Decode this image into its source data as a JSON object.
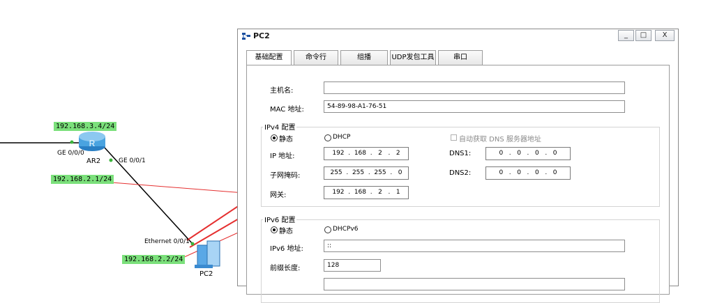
{
  "topology": {
    "router_name": "AR2",
    "router_port_left": "GE 0/0/0",
    "router_port_right": "GE 0/0/1",
    "router_ip_top": "192.168.3.4/24",
    "router_ip_mid": "192.168.2.1/24",
    "pc_port": "Ethernet 0/0/1",
    "pc_ip": "192.168.2.2/24",
    "pc_name": "PC2",
    "tag_color": "#7be07b",
    "arrow_color": "#e53030"
  },
  "window": {
    "title": "PC2",
    "controls": {
      "minimize": "_",
      "maximize": "□",
      "close": "X"
    }
  },
  "tabs": [
    {
      "label": "基础配置",
      "active": true
    },
    {
      "label": "命令行",
      "active": false
    },
    {
      "label": "组播",
      "active": false
    },
    {
      "label": "UDP发包工具",
      "active": false
    },
    {
      "label": "串口",
      "active": false
    }
  ],
  "basic": {
    "hostname_label": "主机名:",
    "hostname_value": "",
    "mac_label": "MAC 地址:",
    "mac_value": "54-89-98-A1-76-51"
  },
  "ipv4": {
    "group_title": "IPv4 配置",
    "static_label": "静态",
    "dhcp_label": "DHCP",
    "auto_dns_label": "自动获取 DNS 服务器地址",
    "ip_label": "IP 地址:",
    "ip_value": "192  .  168  .   2   .   2",
    "mask_label": "子网掩码:",
    "mask_value": "255  .  255  .  255  .   0",
    "gateway_label": "网关:",
    "gateway_value": "192  .  168  .   2   .   1",
    "dns1_label": "DNS1:",
    "dns1_value": "0   .   0   .   0   .   0",
    "dns2_label": "DNS2:",
    "dns2_value": "0   .   0   .   0   .   0"
  },
  "ipv6": {
    "group_title": "IPv6 配置",
    "static_label": "静态",
    "dhcp_label": "DHCPv6",
    "ip_label": "IPv6 地址:",
    "ip_value": "::",
    "prefix_label": "前缀长度:",
    "prefix_value": "128"
  }
}
